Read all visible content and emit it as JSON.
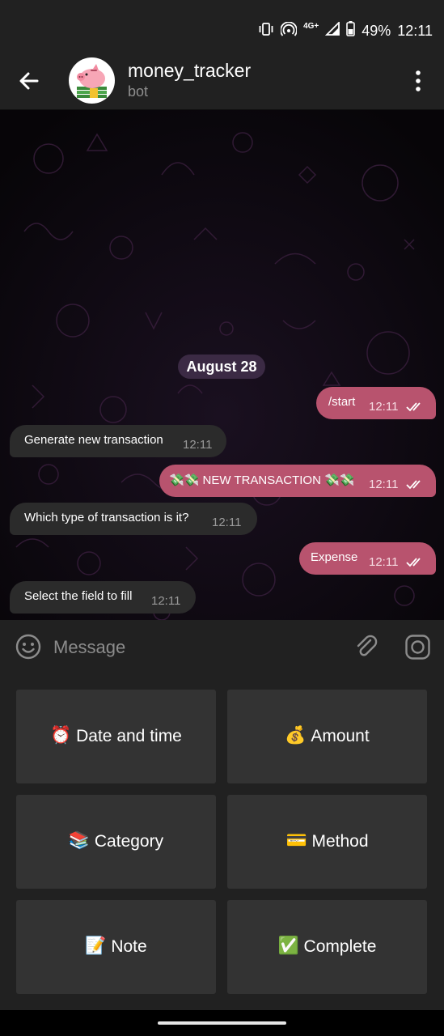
{
  "status_bar": {
    "network": "4G+",
    "battery": "49%",
    "time": "12:11"
  },
  "header": {
    "back_icon": "arrow-left-icon",
    "title": "money_tracker",
    "subtitle": "bot",
    "menu_icon": "more-vert-icon"
  },
  "chat": {
    "date": "August 28",
    "messages": [
      {
        "direction": "out",
        "text": "/start",
        "time": "12:11"
      },
      {
        "direction": "in",
        "text": "Generate new transaction",
        "time": "12:11"
      },
      {
        "direction": "out",
        "text": "💸💸 NEW TRANSACTION 💸💸",
        "time": "12:11"
      },
      {
        "direction": "in",
        "text": "Which type of transaction is it?",
        "time": "12:11"
      },
      {
        "direction": "out",
        "text": "Expense",
        "time": "12:11"
      },
      {
        "direction": "in",
        "text": "Select the field to fill",
        "time": "12:11"
      }
    ]
  },
  "input": {
    "placeholder": "Message",
    "emoji_icon": "emoji-icon",
    "attach_icon": "paperclip-icon",
    "camera_icon": "camera-icon"
  },
  "keyboard": {
    "buttons": [
      {
        "emoji": "⏰",
        "label": "Date and time"
      },
      {
        "emoji": "💰",
        "label": "Amount"
      },
      {
        "emoji": "📚",
        "label": "Category"
      },
      {
        "emoji": "💳",
        "label": "Method"
      },
      {
        "emoji": "📝",
        "label": "Note"
      },
      {
        "emoji": "✅",
        "label": "Complete"
      }
    ]
  },
  "colors": {
    "outgoing_bubble": "#b8536e",
    "incoming_bubble": "#2b2b2b",
    "header": "#212121",
    "keyboard_button": "#333333",
    "date_pill": "#3b2a44"
  }
}
